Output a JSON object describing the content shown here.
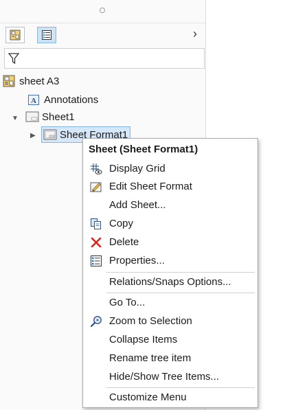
{
  "panel": {
    "tabs": [
      {
        "icon": "property-manager-icon"
      },
      {
        "icon": "feature-manager-tree-icon",
        "active": true
      }
    ],
    "expand_icon": "chevron-right-icon",
    "filter_icon": "funnel-filter-icon"
  },
  "tree": {
    "root": {
      "label": "sheet A3",
      "icon": "drawing-document-icon"
    },
    "annotations": {
      "label": "Annotations",
      "icon": "annotation-A-icon"
    },
    "sheet": {
      "label": "Sheet1",
      "icon": "sheet-icon",
      "expanded": true
    },
    "sheet_format": {
      "label": "Sheet Format1",
      "icon": "sheet-format-icon",
      "selected": true
    }
  },
  "context_menu": {
    "title": "Sheet (Sheet Format1)",
    "items": [
      {
        "label": "Display Grid",
        "icon": "grid-eye-icon"
      },
      {
        "label": "Edit Sheet Format",
        "icon": "edit-pencil-icon"
      },
      {
        "label": "Add Sheet...",
        "icon": ""
      },
      {
        "label": "Copy",
        "icon": "copy-icon"
      },
      {
        "label": "Delete",
        "icon": "delete-x-icon"
      },
      {
        "label": "Properties...",
        "icon": "properties-icon"
      },
      {
        "label": "Relations/Snaps Options...",
        "icon": ""
      },
      {
        "label": "Go To...",
        "icon": ""
      },
      {
        "label": "Zoom to Selection",
        "icon": "zoom-to-selection-icon"
      },
      {
        "label": "Collapse Items",
        "icon": ""
      },
      {
        "label": "Rename tree item",
        "icon": ""
      },
      {
        "label": "Hide/Show Tree Items...",
        "icon": ""
      },
      {
        "label": "Customize Menu",
        "icon": ""
      }
    ],
    "colors": {
      "delete": "#e0201b",
      "selection": "#d5e7f8"
    }
  }
}
